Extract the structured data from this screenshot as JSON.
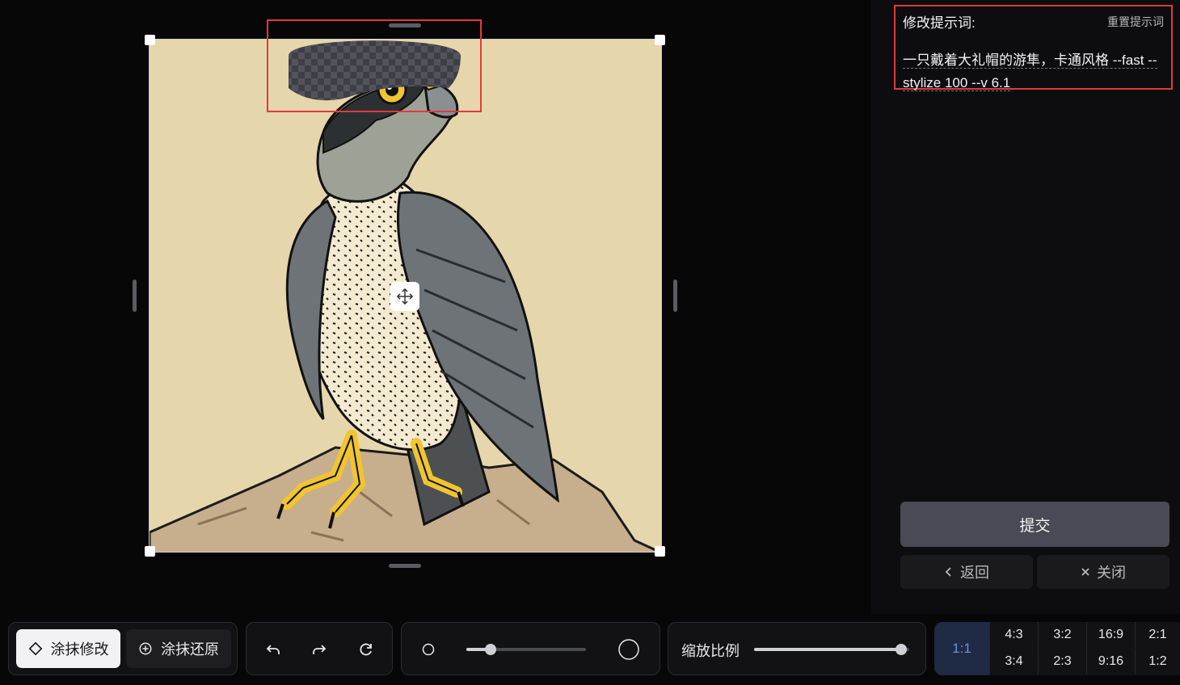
{
  "editor": {
    "tools": {
      "paint_edit_label": "涂抹修改",
      "paint_restore_label": "涂抹还原"
    },
    "history": {
      "undo_icon": "undo-icon",
      "redo_icon": "redo-icon",
      "reset_icon": "refresh-icon"
    },
    "brush_size": {
      "level": 0.2
    },
    "zoom": {
      "label": "缩放比例",
      "level": 0.95
    },
    "aspect_ratios": {
      "selected": "1:1",
      "options_top": [
        "4:3",
        "3:2",
        "16:9",
        "2:1"
      ],
      "options_bottom": [
        "3:4",
        "2:3",
        "9:16",
        "1:2"
      ]
    }
  },
  "prompt_panel": {
    "title": "修改提示词:",
    "reset_label": "重置提示词",
    "prompt_text": "一只戴着大礼帽的游隼，卡通风格 --fast --stylize 100 --v 6.1"
  },
  "actions": {
    "submit_label": "提交",
    "back_label": "返回",
    "close_label": "关闭"
  },
  "colors": {
    "highlight": "#e03a3a",
    "accent": "#6d8fe0",
    "background": "#070708"
  }
}
